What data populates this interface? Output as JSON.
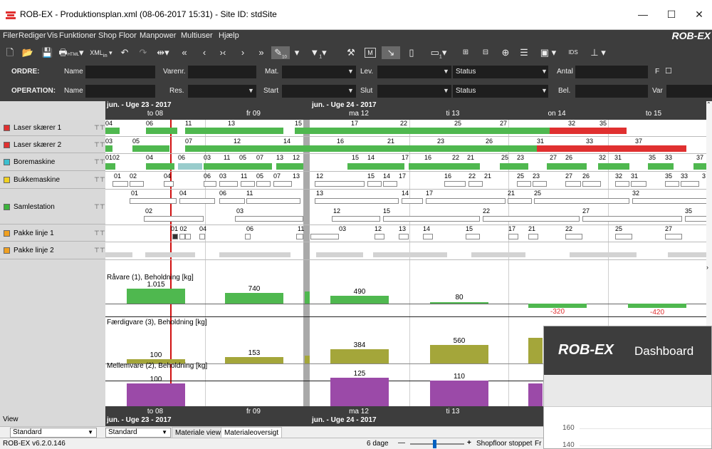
{
  "window": {
    "title": "ROB-EX - Produktionsplan.xml (08-06-2017 15:31) - Site ID: stdSite",
    "minimize": "—",
    "maximize": "☐",
    "close": "✕"
  },
  "menu": {
    "items": [
      "Filer",
      "Rediger",
      "Vis",
      "Funktioner",
      "Shop Floor",
      "Manpower",
      "Multiuser",
      "Hjælp"
    ],
    "brand": "ROB-EX"
  },
  "toolbar": {
    "html_label": "HTML",
    "xml_label": "XML",
    "xml_sub": "in",
    "filter_sub": "1",
    "bars_sub": "1",
    "ids_label": "IDS",
    "pick_sub": "10"
  },
  "order_filter": {
    "title": "ORDRE:",
    "labels": [
      "Name",
      "Varenr.",
      "Mat.",
      "Lev.",
      "Status",
      "Antal",
      "F"
    ]
  },
  "operation_filter": {
    "title": "OPERATION:",
    "labels": [
      "Name",
      "Res.",
      "Start",
      "Slut",
      "Status",
      "Bel.",
      "Var"
    ]
  },
  "timeline": {
    "week1": "jun. - Uge 23 - 2017",
    "week2": "jun. - Uge 24 - 2017",
    "days": [
      "to 08",
      "fr 09",
      "ma 12",
      "ti 13",
      "on 14",
      "to 15"
    ]
  },
  "resources": [
    {
      "name": "Laser skærer 1",
      "color": "#e03030"
    },
    {
      "name": "Laser skærer 2",
      "color": "#e03030"
    },
    {
      "name": "Boremaskine",
      "color": "#3cc0d0"
    },
    {
      "name": "Bukkemaskine",
      "color": "#f0d020"
    },
    {
      "name": "Samlestation",
      "color": "#3cb43c"
    },
    {
      "name": "Pakke linje 1",
      "color": "#f0a020"
    },
    {
      "name": "Pakke linje 2",
      "color": "#f0a020"
    }
  ],
  "rows": {
    "laser1": [
      "04",
      "06",
      "11",
      "13",
      "15",
      "17",
      "22",
      "25",
      "27",
      "32",
      "35"
    ],
    "laser2": [
      "03",
      "05",
      "07",
      "12",
      "14",
      "16",
      "21",
      "23",
      "26",
      "31",
      "33",
      "37"
    ],
    "bore": [
      "0102",
      "04",
      "06",
      "03",
      "11",
      "05",
      "07",
      "13",
      "12",
      "15",
      "14",
      "17",
      "16",
      "22",
      "21",
      "25",
      "23",
      "27",
      "26",
      "32",
      "31",
      "35",
      "33",
      "37"
    ],
    "bukke": [
      "01",
      "02",
      "04",
      "06",
      "03",
      "11",
      "05",
      "07",
      "13",
      "12",
      "15",
      "14",
      "17",
      "16",
      "22",
      "21",
      "25",
      "23",
      "27",
      "26",
      "32",
      "31",
      "35",
      "33",
      "3"
    ],
    "samle_top": [
      "01",
      "04",
      "06",
      "11",
      "13",
      "14",
      "17",
      "21",
      "25",
      "32"
    ],
    "samle_bottom": [
      "02",
      "03",
      "12",
      "15",
      "22",
      "27",
      "35"
    ],
    "pakke1": [
      "01 02",
      "04",
      "06",
      "11",
      "03",
      "12",
      "13",
      "14",
      "15",
      "17",
      "21",
      "22",
      "25",
      "27"
    ]
  },
  "materials": [
    {
      "title": "Råvare (1), Beholdning [kg]",
      "values": [
        "1.015",
        "740",
        "490",
        "80",
        "-320",
        "-420"
      ],
      "color": "#4fb84f"
    },
    {
      "title": "Færdigvare (3), Beholdning [kg]",
      "values": [
        "100",
        "153",
        "384",
        "560"
      ],
      "color": "#a4a63a"
    },
    {
      "title": "Mellemvare (2), Beholdning [kg]",
      "values": [
        "100",
        "125",
        "110"
      ],
      "color": "#9b4aa8"
    }
  ],
  "view": {
    "label": "View",
    "left_select": "Standard",
    "right_select": "Standard",
    "tabs": [
      "Materiale view",
      "Materialeoversigt"
    ]
  },
  "status": {
    "version": "ROB-EX v6.2.0.146",
    "days": "6 dage",
    "minus": "—",
    "plus": "+",
    "shopfloor": "Shopfloor stoppet",
    "trunc": "Fr"
  },
  "dashboard": {
    "logo": "ROB-EX",
    "title": "Dashboard",
    "y160": "160",
    "y140": "140"
  }
}
